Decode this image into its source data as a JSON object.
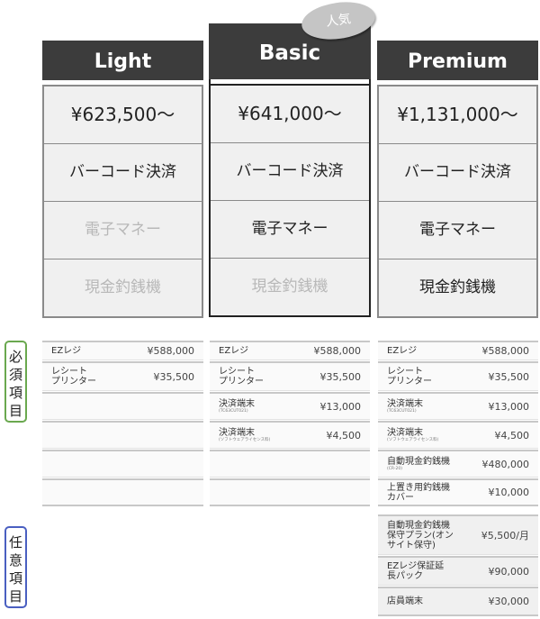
{
  "badge": {
    "label": "人気"
  },
  "plans": [
    {
      "name": "Light",
      "price": "¥623,500～",
      "features": [
        {
          "label": "バーコード決済",
          "included": true
        },
        {
          "label": "電子マネー",
          "included": false
        },
        {
          "label": "現金釣銭機",
          "included": false
        }
      ]
    },
    {
      "name": "Basic",
      "price": "¥641,000～",
      "popular": true,
      "features": [
        {
          "label": "バーコード決済",
          "included": true
        },
        {
          "label": "電子マネー",
          "included": true
        },
        {
          "label": "現金釣銭機",
          "included": false
        }
      ]
    },
    {
      "name": "Premium",
      "price": "¥1,131,000～",
      "features": [
        {
          "label": "バーコード決済",
          "included": true
        },
        {
          "label": "電子マネー",
          "included": true
        },
        {
          "label": "現金釣銭機",
          "included": true
        }
      ]
    }
  ],
  "categories": {
    "required": "必須項目",
    "optional": "任意項目"
  },
  "items": {
    "light": {
      "required": [
        {
          "name": "EZレジ",
          "sub": "",
          "price": "¥588,000"
        },
        {
          "name": "レシート\nプリンター",
          "sub": "",
          "price": "¥35,500"
        }
      ]
    },
    "basic": {
      "required": [
        {
          "name": "EZレジ",
          "sub": "",
          "price": "¥588,000"
        },
        {
          "name": "レシート\nプリンター",
          "sub": "",
          "price": "¥35,500"
        },
        {
          "name": "決済端末",
          "sub": "(TC63CUT021)",
          "price": "¥13,000"
        },
        {
          "name": "決済端末",
          "sub": "(ソフトウェアライセンス料)",
          "price": "¥4,500"
        }
      ]
    },
    "premium": {
      "required": [
        {
          "name": "EZレジ",
          "sub": "",
          "price": "¥588,000"
        },
        {
          "name": "レシート\nプリンター",
          "sub": "",
          "price": "¥35,500"
        },
        {
          "name": "決済端末",
          "sub": "(TC63CUT021)",
          "price": "¥13,000"
        },
        {
          "name": "決済端末",
          "sub": "(ソフトウェアライセンス料)",
          "price": "¥4,500"
        },
        {
          "name": "自動現金釣銭機",
          "sub": "(CR-20)",
          "price": "¥480,000"
        },
        {
          "name": "上置き用釣銭機\nカバー",
          "sub": "",
          "price": "¥10,000"
        }
      ],
      "optional": [
        {
          "name": "自動現金釣銭機\n保守プラン(オン\nサイト保守)",
          "sub": "",
          "price": "¥5,500/月"
        },
        {
          "name": "EZレジ保証延\n長パック",
          "sub": "",
          "price": "¥90,000"
        },
        {
          "name": "店員端末",
          "sub": "",
          "price": "¥30,000"
        }
      ]
    }
  }
}
